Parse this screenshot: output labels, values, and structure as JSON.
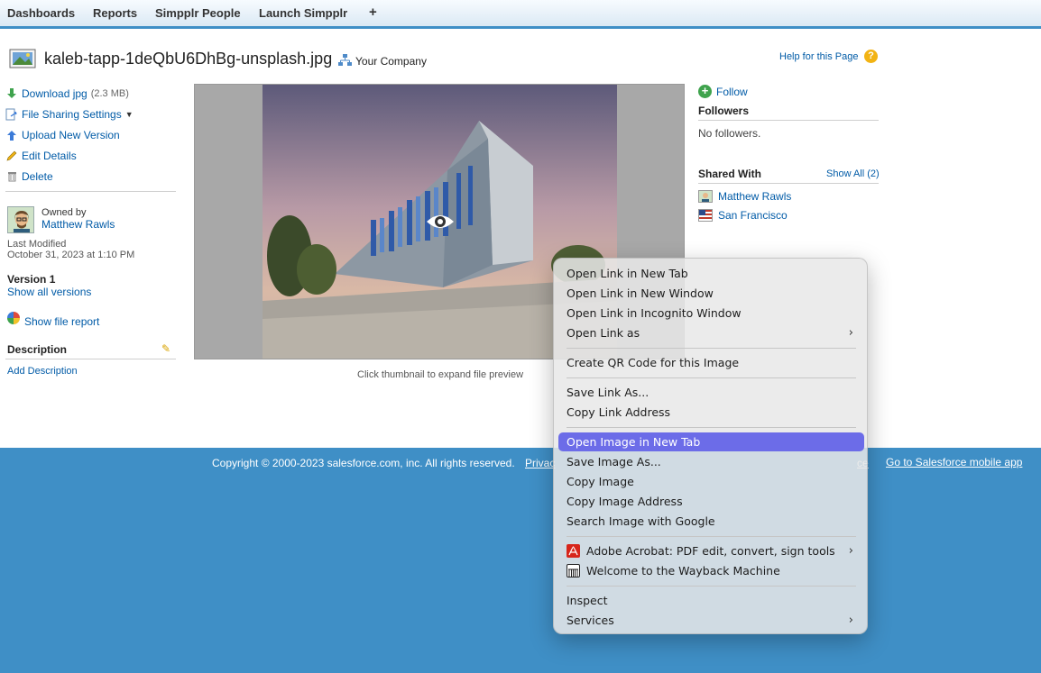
{
  "tabs": [
    {
      "label": "Dashboards"
    },
    {
      "label": "Reports"
    },
    {
      "label": "Simpplr People"
    },
    {
      "label": "Launch Simpplr"
    },
    {
      "label": "+"
    }
  ],
  "header": {
    "title": "kaleb-tapp-1deQbU6DhBg-unsplash.jpg",
    "org": "Your Company",
    "help": "Help for this Page",
    "help_icon": "?"
  },
  "actions": {
    "download": "Download jpg",
    "download_size": "(2.3 MB)",
    "sharing": "File Sharing Settings",
    "upload": "Upload New Version",
    "edit": "Edit Details",
    "delete": "Delete"
  },
  "owner": {
    "owned_by": "Owned by",
    "name": "Matthew Rawls",
    "last_modified_label": "Last Modified",
    "last_modified": "October 31, 2023 at 1:10 PM",
    "version": "Version 1",
    "show_versions": "Show all versions",
    "file_report": "Show file report"
  },
  "description": {
    "heading": "Description",
    "add": "Add Description"
  },
  "preview": {
    "caption": "Click thumbnail to expand file preview"
  },
  "right": {
    "follow": "Follow",
    "follow_icon": "+",
    "followers_heading": "Followers",
    "no_followers": "No followers.",
    "shared_heading": "Shared With",
    "show_all": "Show All (2)",
    "shared": [
      {
        "name": "Matthew Rawls",
        "icon": "user-avatar-icon"
      },
      {
        "name": "San Francisco",
        "icon": "us-flag-icon"
      }
    ]
  },
  "footer": {
    "copyright": "Copyright © 2000-2023 salesforce.com, inc. All rights reserved.",
    "privacy": "Privac",
    "fragment": "ce",
    "mobile": "Go to Salesforce mobile app"
  },
  "context_menu": {
    "highlight_color": "#6c6ce8",
    "items": [
      {
        "label": "Open Link in New Tab"
      },
      {
        "label": "Open Link in New Window"
      },
      {
        "label": "Open Link in Incognito Window"
      },
      {
        "label": "Open Link as",
        "submenu": "›"
      },
      {
        "label": "Create QR Code for this Image"
      },
      {
        "label": "Save Link As..."
      },
      {
        "label": "Copy Link Address"
      },
      {
        "label": "Open Image in New Tab",
        "highlighted": true
      },
      {
        "label": "Save Image As..."
      },
      {
        "label": "Copy Image"
      },
      {
        "label": "Copy Image Address"
      },
      {
        "label": "Search Image with Google"
      },
      {
        "label": "Adobe Acrobat: PDF edit, convert, sign tools",
        "submenu": "›",
        "icon": "adobe-acrobat-icon"
      },
      {
        "label": "Welcome to the Wayback Machine",
        "icon": "wayback-machine-icon"
      },
      {
        "label": "Inspect"
      },
      {
        "label": "Services",
        "submenu": "›"
      }
    ]
  },
  "colors": {
    "brand_blue": "#3f8fc6",
    "link": "#015ba7"
  }
}
